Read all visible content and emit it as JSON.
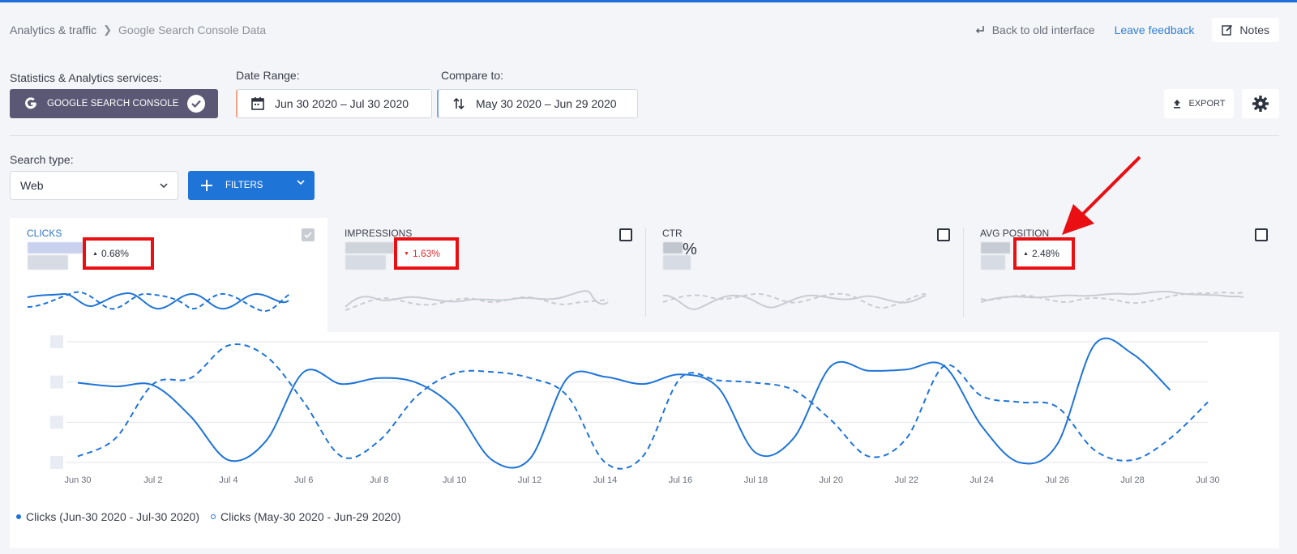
{
  "breadcrumb": {
    "parent": "Analytics & traffic",
    "current": "Google Search Console Data"
  },
  "header": {
    "back_label": "Back to old interface",
    "feedback_label": "Leave feedback",
    "notes_label": "Notes"
  },
  "controls": {
    "services_label": "Statistics & Analytics services:",
    "service_button": "GOOGLE SEARCH CONSOLE",
    "date_range_label": "Date Range:",
    "date_range_value": "Jun 30 2020 – Jul 30 2020",
    "compare_label": "Compare to:",
    "compare_value": "May 30 2020 – Jun 29 2020",
    "export_label": "EXPORT",
    "search_type_label": "Search type:",
    "search_type_value": "Web",
    "filters_label": "FILTERS"
  },
  "metrics": [
    {
      "name": "CLICKS",
      "delta": "0.68%",
      "direction": "up",
      "selected": true
    },
    {
      "name": "IMPRESSIONS",
      "delta": "1.63%",
      "direction": "down",
      "selected": false
    },
    {
      "name": "CTR",
      "value_suffix": "%",
      "selected": false
    },
    {
      "name": "AVG POSITION",
      "delta": "2.48%",
      "direction": "up",
      "selected": false
    }
  ],
  "colors": {
    "accent": "#1f74d8",
    "highlight": "#e90f13",
    "negative": "#e02a2a",
    "service_button": "#5a5875"
  },
  "chart_data": {
    "type": "line",
    "x": [
      "Jun 30",
      "Jul 1",
      "Jul 2",
      "Jul 3",
      "Jul 4",
      "Jul 5",
      "Jul 6",
      "Jul 7",
      "Jul 8",
      "Jul 9",
      "Jul 10",
      "Jul 11",
      "Jul 12",
      "Jul 13",
      "Jul 14",
      "Jul 15",
      "Jul 16",
      "Jul 17",
      "Jul 18",
      "Jul 19",
      "Jul 20",
      "Jul 21",
      "Jul 22",
      "Jul 23",
      "Jul 24",
      "Jul 25",
      "Jul 26",
      "Jul 27",
      "Jul 28",
      "Jul 29",
      "Jul 30"
    ],
    "tick_labels": [
      "Jun 30",
      "Jul 2",
      "Jul 4",
      "Jul 6",
      "Jul 8",
      "Jul 10",
      "Jul 12",
      "Jul 14",
      "Jul 16",
      "Jul 18",
      "Jul 20",
      "Jul 22",
      "Jul 24",
      "Jul 26",
      "Jul 28",
      "Jul 30"
    ],
    "series": [
      {
        "name": "Clicks (Jun-30 2020 - Jul-30 2020)",
        "style": "solid",
        "values": [
          0.66,
          0.63,
          0.64,
          0.38,
          0.02,
          0.18,
          0.75,
          0.65,
          0.7,
          0.66,
          0.45,
          0.02,
          0.03,
          0.7,
          0.71,
          0.65,
          0.73,
          0.62,
          0.08,
          0.2,
          0.8,
          0.76,
          0.77,
          0.8,
          0.3,
          0.0,
          0.15,
          0.98,
          0.9,
          0.6,
          null
        ]
      },
      {
        "name": "Clicks (May-30 2020 - Jun-29 2020)",
        "style": "dashed",
        "values": [
          0.05,
          0.2,
          0.65,
          0.7,
          0.97,
          0.88,
          0.5,
          0.05,
          0.18,
          0.55,
          0.74,
          0.75,
          0.7,
          0.55,
          0.0,
          0.05,
          0.7,
          0.68,
          0.66,
          0.6,
          0.35,
          0.05,
          0.2,
          0.8,
          0.55,
          0.5,
          0.46,
          0.1,
          0.02,
          0.2,
          0.5
        ]
      }
    ],
    "ylim": [
      0,
      1
    ],
    "grid": true,
    "legend": "bottom-left"
  }
}
